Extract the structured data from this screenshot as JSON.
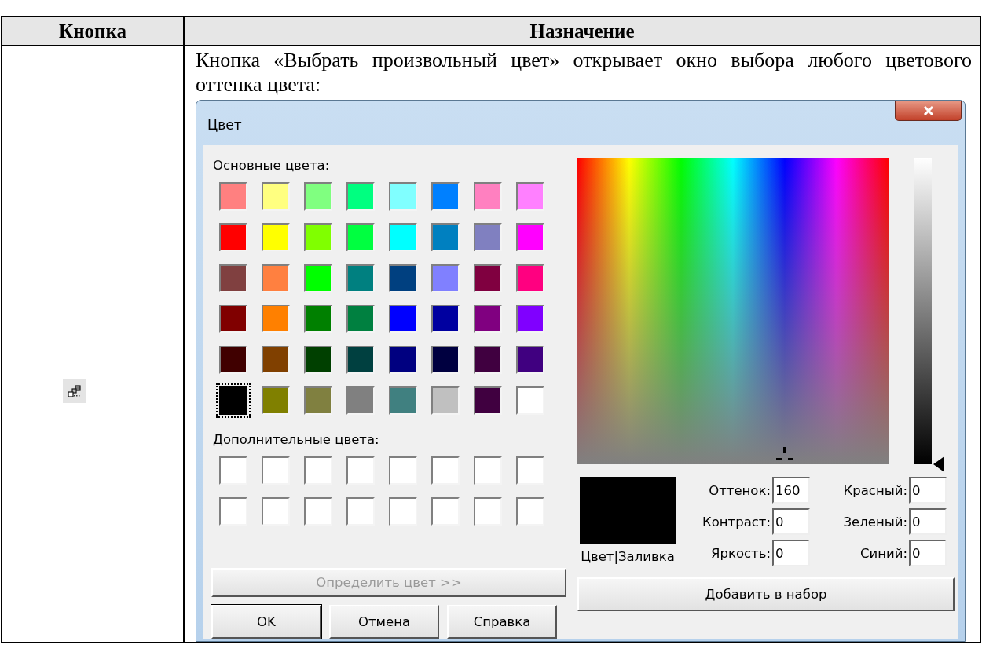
{
  "table": {
    "columns": [
      "Кнопка",
      "Назначение"
    ],
    "rows": [
      {
        "description": "Кнопка «Выбрать произвольный цвет» открывает окно выбора любого цветового оттенка цвета:",
        "dialog": {
          "title": "Цвет",
          "basic_colors_label": "Основные цвета:",
          "basic_colors": [
            {
              "color": "#ff8080",
              "selected": false
            },
            {
              "color": "#ffff80",
              "selected": false
            },
            {
              "color": "#80ff80",
              "selected": false
            },
            {
              "color": "#00ff80",
              "selected": false
            },
            {
              "color": "#80ffff",
              "selected": false
            },
            {
              "color": "#0080ff",
              "selected": false
            },
            {
              "color": "#ff80c0",
              "selected": false
            },
            {
              "color": "#ff80ff",
              "selected": false
            },
            {
              "color": "#ff0000",
              "selected": false
            },
            {
              "color": "#ffff00",
              "selected": false
            },
            {
              "color": "#80ff00",
              "selected": false
            },
            {
              "color": "#00ff40",
              "selected": false
            },
            {
              "color": "#00ffff",
              "selected": false
            },
            {
              "color": "#0080c0",
              "selected": false
            },
            {
              "color": "#8080c0",
              "selected": false
            },
            {
              "color": "#ff00ff",
              "selected": false
            },
            {
              "color": "#804040",
              "selected": false
            },
            {
              "color": "#ff8040",
              "selected": false
            },
            {
              "color": "#00ff00",
              "selected": false
            },
            {
              "color": "#008080",
              "selected": false
            },
            {
              "color": "#004080",
              "selected": false
            },
            {
              "color": "#8080ff",
              "selected": false
            },
            {
              "color": "#800040",
              "selected": false
            },
            {
              "color": "#ff0080",
              "selected": false
            },
            {
              "color": "#800000",
              "selected": false
            },
            {
              "color": "#ff8000",
              "selected": false
            },
            {
              "color": "#008000",
              "selected": false
            },
            {
              "color": "#008040",
              "selected": false
            },
            {
              "color": "#0000ff",
              "selected": false
            },
            {
              "color": "#0000a0",
              "selected": false
            },
            {
              "color": "#800080",
              "selected": false
            },
            {
              "color": "#8000ff",
              "selected": false
            },
            {
              "color": "#400000",
              "selected": false
            },
            {
              "color": "#804000",
              "selected": false
            },
            {
              "color": "#004000",
              "selected": false
            },
            {
              "color": "#004040",
              "selected": false
            },
            {
              "color": "#000080",
              "selected": false
            },
            {
              "color": "#000040",
              "selected": false
            },
            {
              "color": "#400040",
              "selected": false
            },
            {
              "color": "#400080",
              "selected": false
            },
            {
              "color": "#000000",
              "selected": true
            },
            {
              "color": "#808000",
              "selected": false
            },
            {
              "color": "#808040",
              "selected": false
            },
            {
              "color": "#808080",
              "selected": false
            },
            {
              "color": "#408080",
              "selected": false
            },
            {
              "color": "#c0c0c0",
              "selected": false
            },
            {
              "color": "#400040",
              "selected": false
            },
            {
              "color": "#ffffff",
              "selected": false
            }
          ],
          "custom_colors_label": "Дополнительные цвета:",
          "custom_colors": [
            {
              "color": "#ffffff"
            },
            {
              "color": "#ffffff"
            },
            {
              "color": "#ffffff"
            },
            {
              "color": "#ffffff"
            },
            {
              "color": "#ffffff"
            },
            {
              "color": "#ffffff"
            },
            {
              "color": "#ffffff"
            },
            {
              "color": "#ffffff"
            },
            {
              "color": "#ffffff"
            },
            {
              "color": "#ffffff"
            },
            {
              "color": "#ffffff"
            },
            {
              "color": "#ffffff"
            },
            {
              "color": "#ffffff"
            },
            {
              "color": "#ffffff"
            },
            {
              "color": "#ffffff"
            },
            {
              "color": "#ffffff"
            }
          ],
          "define_button": {
            "label": "Определить цвет >>",
            "disabled": true
          },
          "buttons": [
            "OK",
            "Отмена",
            "Справка"
          ],
          "color_solid_label": "Цвет|Заливка",
          "fields": [
            {
              "label": "Оттенок:",
              "value": "160"
            },
            {
              "label": "Красный:",
              "value": "0"
            },
            {
              "label": "Контраст:",
              "value": "0"
            },
            {
              "label": "Зеленый:",
              "value": "0"
            },
            {
              "label": "Яркость:",
              "value": "0"
            },
            {
              "label": "Синий:",
              "value": "0"
            }
          ],
          "add_button": "Добавить в набор"
        }
      }
    ]
  }
}
